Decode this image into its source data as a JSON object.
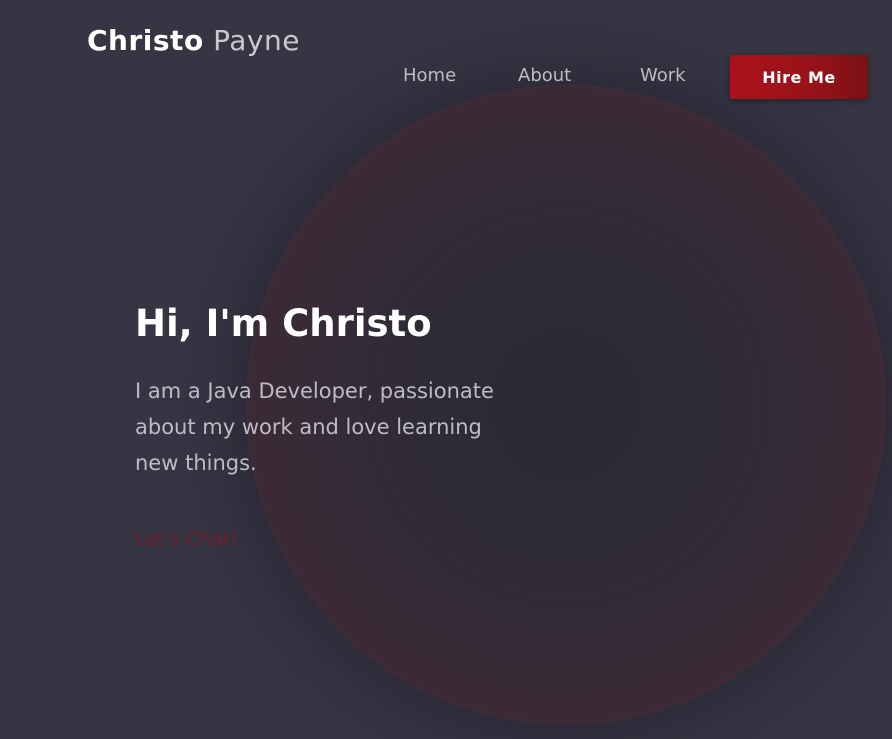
{
  "brand": {
    "first_name": "Christo",
    "last_name": "Payne"
  },
  "nav": {
    "items": [
      {
        "label": "Home"
      },
      {
        "label": "About"
      },
      {
        "label": "Work"
      }
    ],
    "cta_label": "Hire Me"
  },
  "hero": {
    "title": "Hi, I'm Christo",
    "description": "I am a Java Developer, passionate about my work and love learning new things.",
    "link_label": "Let's Chat!"
  },
  "colors": {
    "background": "#363543",
    "accent": "#9a1219",
    "heading": "#ffffff",
    "body_text": "#bdbcc6",
    "link": "#6e2028"
  }
}
